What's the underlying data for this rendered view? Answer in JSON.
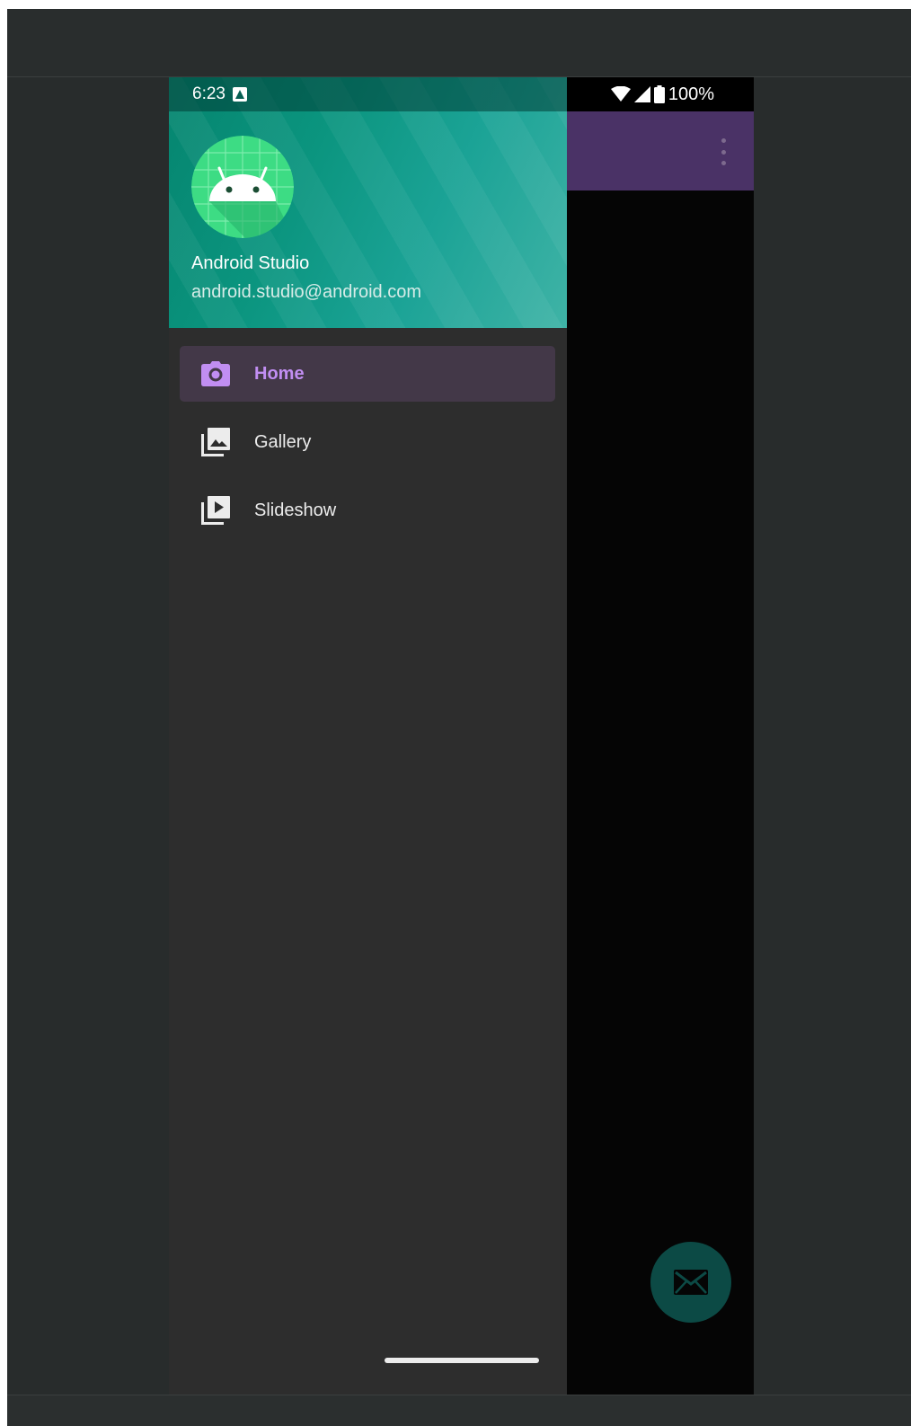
{
  "status_bar": {
    "time": "6:23",
    "battery": "100%"
  },
  "drawer": {
    "profile": {
      "name": "Android Studio",
      "email": "android.studio@android.com",
      "avatar_icon": "android-robot-icon"
    },
    "items": [
      {
        "label": "Home",
        "icon": "camera-icon",
        "active": true
      },
      {
        "label": "Gallery",
        "icon": "gallery-icon",
        "active": false
      },
      {
        "label": "Slideshow",
        "icon": "slideshow-icon",
        "active": false
      }
    ]
  },
  "app": {
    "overflow_icon": "more-vert-icon",
    "fab_icon": "mail-icon"
  },
  "colors": {
    "accent": "#c18ef2",
    "app_bar": "#4a3266",
    "header_teal": "#0b957f",
    "fab": "#0c4a45"
  }
}
